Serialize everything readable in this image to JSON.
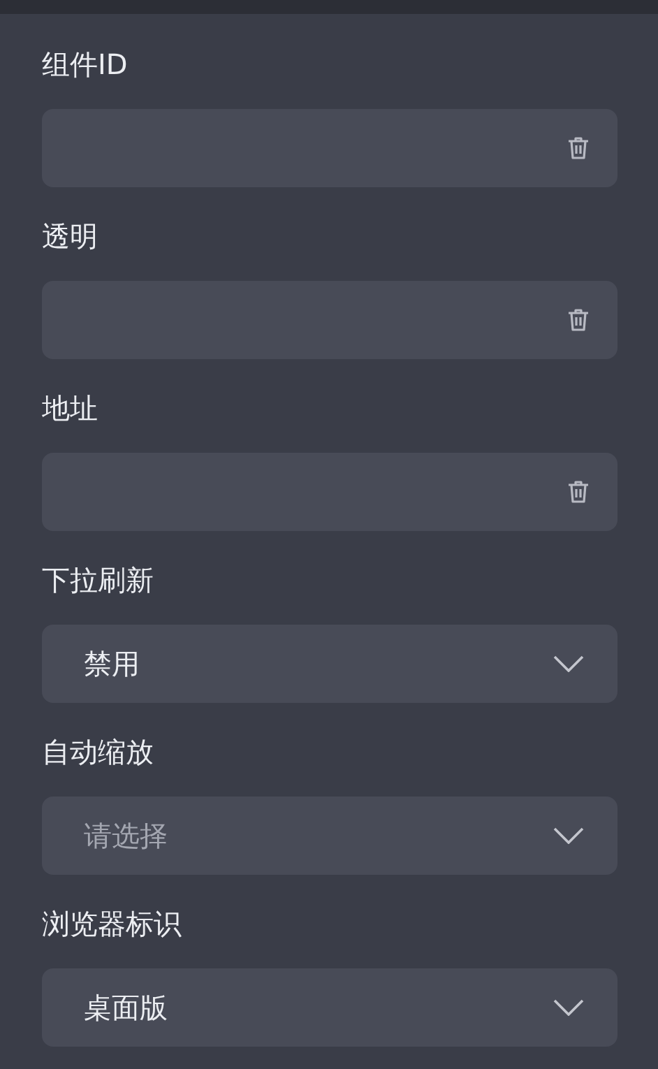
{
  "fields": [
    {
      "kind": "input",
      "label": "组件ID"
    },
    {
      "kind": "input",
      "label": "透明"
    },
    {
      "kind": "input",
      "label": "地址"
    },
    {
      "kind": "select",
      "label": "下拉刷新",
      "value": "禁用"
    },
    {
      "kind": "select",
      "label": "自动缩放",
      "placeholder": "请选择"
    },
    {
      "kind": "select",
      "label": "浏览器标识",
      "value": "桌面版"
    }
  ]
}
